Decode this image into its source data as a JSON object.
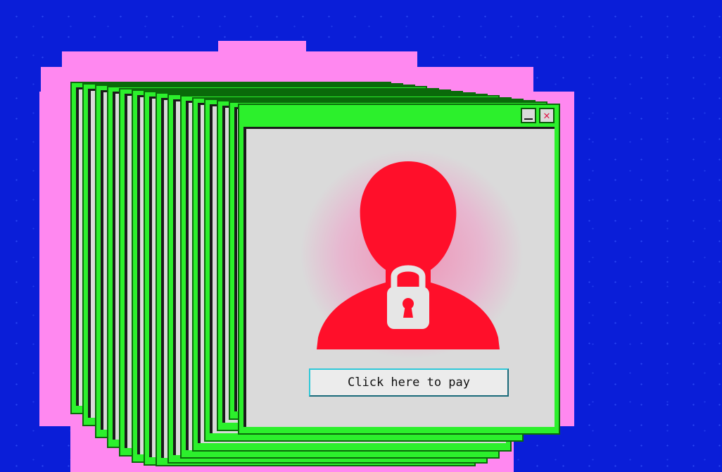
{
  "window": {
    "minimize_icon": "minimize-icon",
    "close_label": "✕",
    "close_icon": "close-icon"
  },
  "dialog": {
    "icon": "locked-user-icon",
    "action_button_label": "Click here to pay"
  },
  "colors": {
    "background": "#0a1ed8",
    "window_frame": "#2cf02c",
    "window_body": "#dadada",
    "halo": "#ff88f0",
    "icon_red": "#ff0f2a"
  }
}
